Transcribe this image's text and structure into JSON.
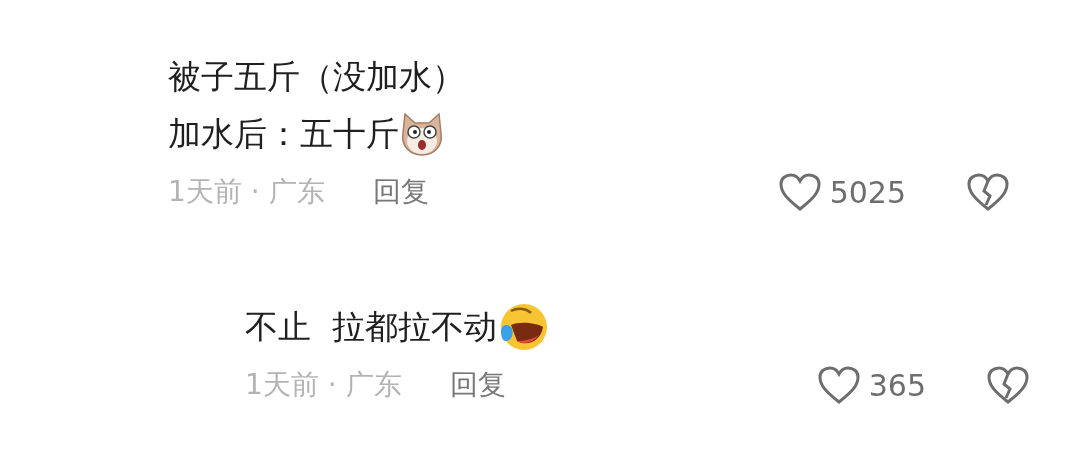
{
  "comments": [
    {
      "kind": "comment",
      "lines": [
        "被子五斤（没加水）",
        "加水后：五十斤"
      ],
      "emoji": {
        "kind": "dog"
      },
      "time": "1天前 · 广东",
      "reply_label": "回复",
      "likes": "5025"
    },
    {
      "kind": "reply",
      "lines": [
        "不止  拉都拉不动"
      ],
      "emoji": {
        "kind": "laugh"
      },
      "time": "1天前 · 广东",
      "reply_label": "回复",
      "likes": "365"
    }
  ]
}
